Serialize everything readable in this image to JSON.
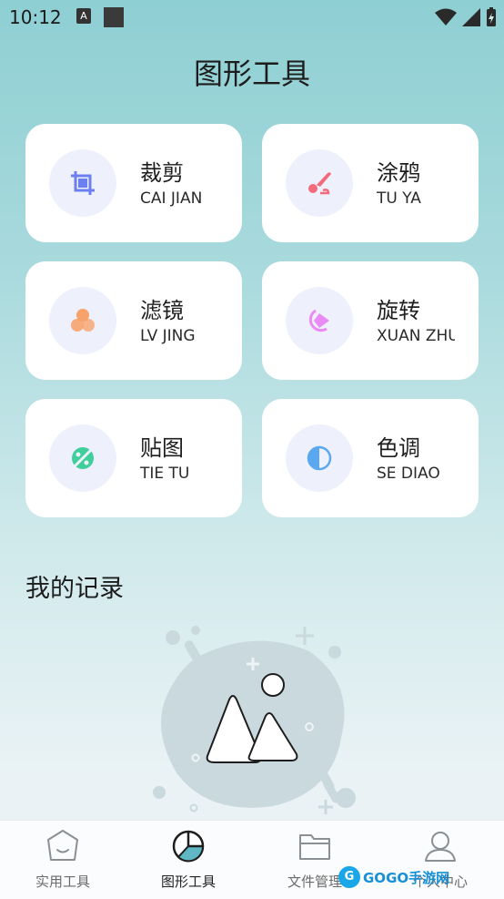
{
  "status_bar": {
    "time": "10:12",
    "notif_letter": "A"
  },
  "header": {
    "title": "图形工具"
  },
  "tools": [
    {
      "cn": "裁剪",
      "en": "CAI JIAN",
      "icon": "crop-icon",
      "color": "#6c7ff0"
    },
    {
      "cn": "涂鸦",
      "en": "TU YA",
      "icon": "brush-icon",
      "color": "#f26b7d"
    },
    {
      "cn": "滤镜",
      "en": "LV JING",
      "icon": "filter-icon",
      "color": "#f7a26b"
    },
    {
      "cn": "旋转",
      "en": "XUAN ZHUAN",
      "icon": "rotate-icon",
      "color": "#e98af5"
    },
    {
      "cn": "贴图",
      "en": "TIE TU",
      "icon": "sticker-icon",
      "color": "#3fcf9a"
    },
    {
      "cn": "色调",
      "en": "SE DIAO",
      "icon": "tone-icon",
      "color": "#5aa8f0"
    }
  ],
  "records": {
    "title": "我的记录"
  },
  "bottom_nav": {
    "items": [
      {
        "label": "实用工具",
        "icon": "home-icon"
      },
      {
        "label": "图形工具",
        "icon": "graphics-icon",
        "active": true
      },
      {
        "label": "文件管理",
        "icon": "folder-icon"
      },
      {
        "label": "个人中心",
        "icon": "person-icon"
      }
    ]
  },
  "watermark": {
    "text": "GOGO手游网"
  }
}
